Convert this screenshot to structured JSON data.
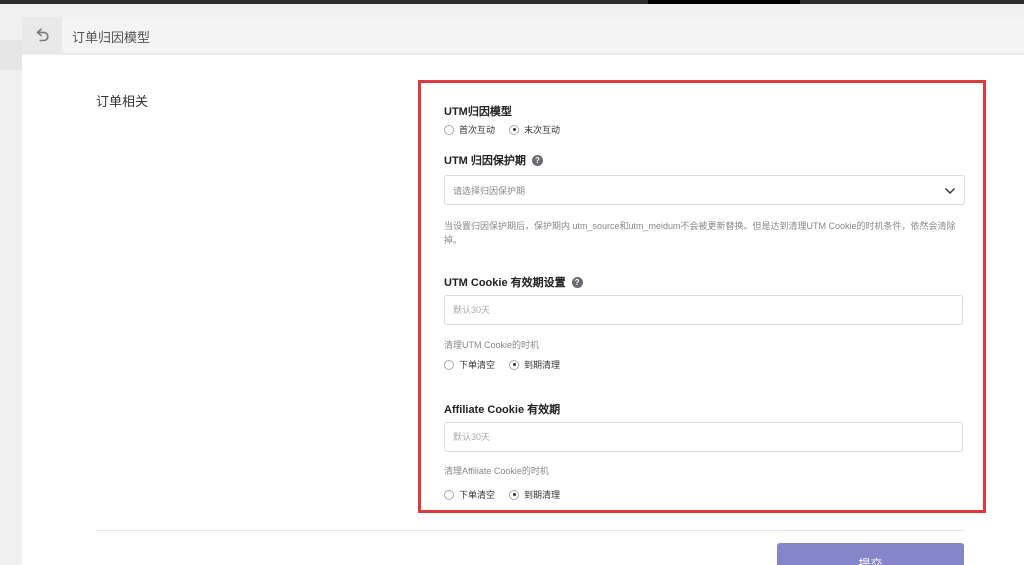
{
  "header": {
    "title": "订单归因模型"
  },
  "section": {
    "label": "订单相关"
  },
  "utm_model": {
    "title": "UTM归因模型",
    "options": [
      "首次互动",
      "末次互动"
    ],
    "selected": "末次互动"
  },
  "utm_protection": {
    "title": "UTM 归因保护期",
    "placeholder": "请选择归因保护期",
    "hint": "当设置归因保护期后，保护期内 utm_source和utm_meidum不会被更新替换。但是达到清理UTM Cookie的时机条件，依然会清除掉。"
  },
  "utm_cookie": {
    "title": "UTM Cookie 有效期设置",
    "placeholder": "默认30天",
    "clear_label": "清理UTM Cookie的时机",
    "options": [
      "下单清空",
      "到期清理"
    ],
    "selected": "到期清理"
  },
  "affiliate_cookie": {
    "title": "Affiliate Cookie 有效期",
    "placeholder": "默认30天",
    "clear_label": "清理Affiliate Cookie的时机",
    "options": [
      "下单清空",
      "到期清理"
    ],
    "selected": "到期清理"
  },
  "submit": {
    "label": "提交"
  },
  "colors": {
    "highlight_border": "#e0393e",
    "submit_button": "#8585c9"
  },
  "icons": {
    "back": "undo-arrow-icon",
    "help": "question-circle-icon",
    "dropdown": "chevron-down-icon"
  }
}
